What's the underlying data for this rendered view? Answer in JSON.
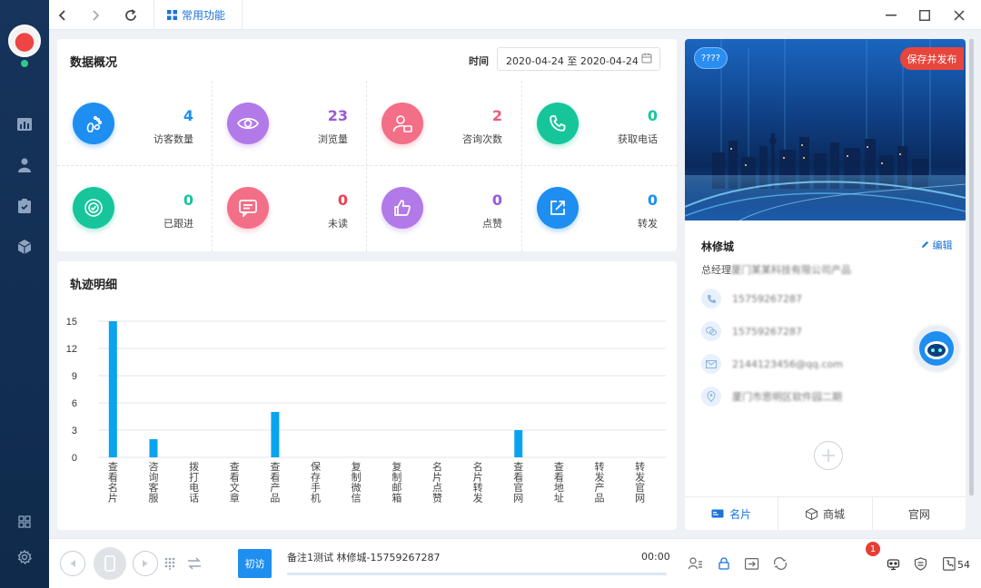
{
  "topbar": {
    "tab_label": "常用功能"
  },
  "overview": {
    "title": "数据概况",
    "time_label": "时间",
    "date_range": "2020-04-24 至 2020-04-24",
    "stats": [
      {
        "value": "4",
        "label": "访客数量",
        "icon": "footprint-icon",
        "color": "#1e8ef0",
        "num_color": "#1e8ef0"
      },
      {
        "value": "23",
        "label": "浏览量",
        "icon": "eye-icon",
        "color": "#b17ae8",
        "num_color": "#9b5ad8"
      },
      {
        "value": "2",
        "label": "咨询次数",
        "icon": "user-chat-icon",
        "color": "#f36e87",
        "num_color": "#ef5a7a"
      },
      {
        "value": "0",
        "label": "获取电话",
        "icon": "phone-icon",
        "color": "#17c59b",
        "num_color": "#17c59b"
      },
      {
        "value": "0",
        "label": "已跟进",
        "icon": "target-icon",
        "color": "#17c59b",
        "num_color": "#17c59b"
      },
      {
        "value": "0",
        "label": "未读",
        "icon": "message-icon",
        "color": "#f36e87",
        "num_color": "#ef3f52"
      },
      {
        "value": "0",
        "label": "点赞",
        "icon": "thumbs-up-icon",
        "color": "#b17ae8",
        "num_color": "#9b5ad8"
      },
      {
        "value": "0",
        "label": "转发",
        "icon": "share-icon",
        "color": "#1e8ef0",
        "num_color": "#1e8ef0"
      }
    ]
  },
  "track": {
    "title": "轨迹明细"
  },
  "chart_data": {
    "type": "bar",
    "title": "轨迹明细",
    "categories": [
      "查看名片",
      "咨询客服",
      "拨打电话",
      "查看文章",
      "查看产品",
      "保存手机",
      "复制微信",
      "复制邮箱",
      "名片点赞",
      "名片转发",
      "查看官网",
      "查看地址",
      "转发产品",
      "转发官网"
    ],
    "values": [
      15,
      2,
      0,
      0,
      5,
      0,
      0,
      0,
      0,
      0,
      3,
      0,
      0,
      0
    ],
    "yticks": [
      0,
      3,
      6,
      9,
      12,
      15
    ],
    "ylim": [
      0,
      15
    ],
    "grid": true,
    "bar_color": "#0aa3f0"
  },
  "card": {
    "tag": "????",
    "save_publish": "保存并发布",
    "name": "林修城",
    "edit_label": "编辑",
    "title_prefix": "总经理",
    "title_company": "厦门某某科技有限公司产品",
    "phone": "15759267287",
    "wechat": "15759267287",
    "email": "2144123456@qq.com",
    "address": "厦门市思明区软件园二期",
    "tabs": [
      {
        "label": "名片",
        "icon": "card-icon"
      },
      {
        "label": "商城",
        "icon": "box-icon"
      },
      {
        "label": "官网",
        "icon": ""
      }
    ]
  },
  "bottombar": {
    "first_visit": "初访",
    "note": "备注1测试   林修城-15759267287",
    "time": "00:00",
    "badge": "1",
    "count": "54"
  }
}
